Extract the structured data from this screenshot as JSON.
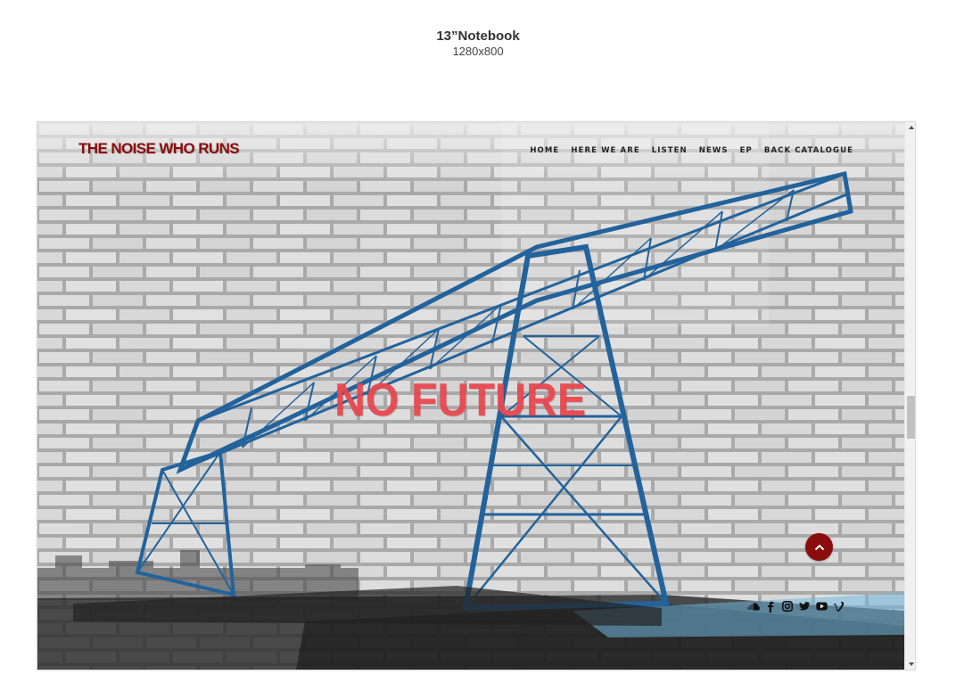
{
  "device": {
    "name": "13”Notebook",
    "resolution": "1280x800"
  },
  "site": {
    "logo_text": "THE NOISE WHO RUNS",
    "nav": [
      {
        "label": "HOME"
      },
      {
        "label": "HERE WE ARE"
      },
      {
        "label": "LISTEN"
      },
      {
        "label": "NEWS"
      },
      {
        "label": "EP"
      },
      {
        "label": "BACK CATALOGUE"
      }
    ],
    "hero_title": "NO FUTURE",
    "scroll_top_icon": "chevron-up-icon",
    "social": [
      {
        "icon": "soundcloud-icon"
      },
      {
        "icon": "facebook-icon"
      },
      {
        "icon": "instagram-icon"
      },
      {
        "icon": "twitter-icon"
      },
      {
        "icon": "youtube-icon"
      },
      {
        "icon": "vimeo-icon"
      }
    ]
  },
  "colors": {
    "logo": "#8a0c0c",
    "hero_title": "#e8484f",
    "bridge": "#2a6aa3",
    "scroll_button": "#8a0c0c",
    "wall": "#d9d9d9"
  }
}
